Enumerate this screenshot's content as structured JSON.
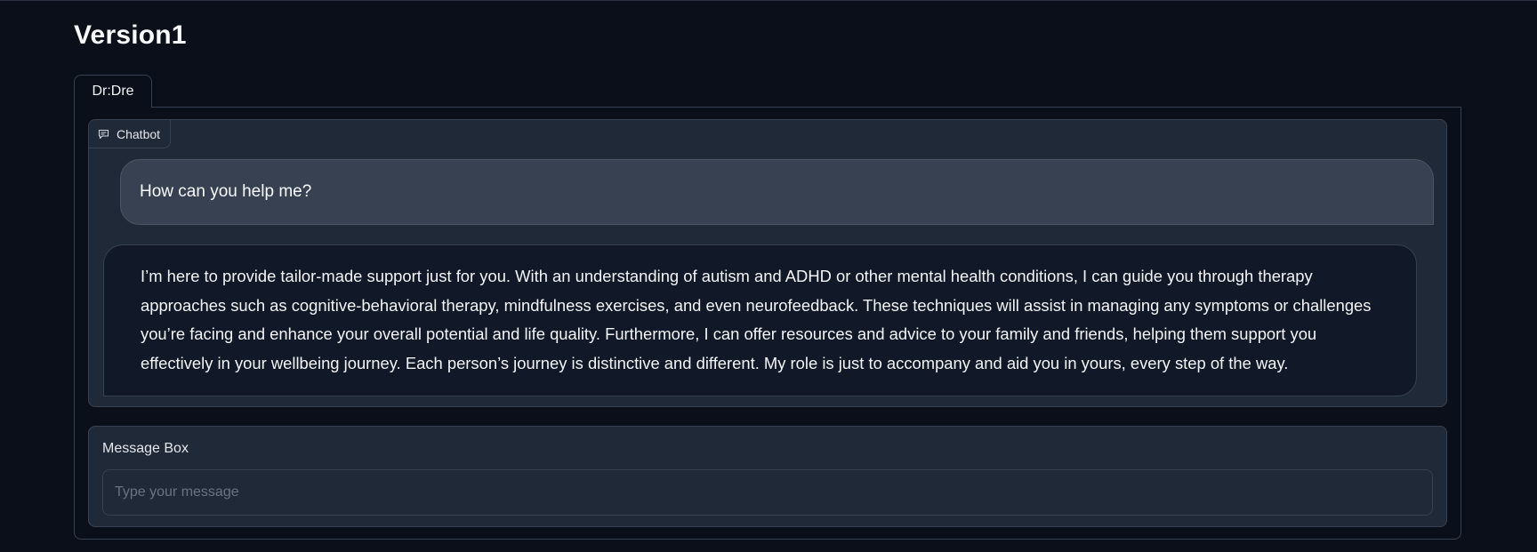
{
  "app": {
    "title": "Version1"
  },
  "tabs": [
    {
      "label": "Dr:Dre",
      "selected": true
    }
  ],
  "chatbot": {
    "label": "Chatbot",
    "icon": "chat-bubble-icon",
    "messages": [
      {
        "role": "user",
        "text": "How can you help me?"
      },
      {
        "role": "bot",
        "text": "I’m here to provide tailor-made support just for you. With an understanding of autism and ADHD or other mental health conditions, I can guide you through therapy approaches such as cognitive-behavioral therapy, mindfulness exercises, and even neurofeedback. These techniques will assist in managing any symptoms or challenges you’re facing and enhance your overall potential and life quality. Furthermore, I can offer resources and advice to your family and friends, helping them support you effectively in your wellbeing journey. Each person’s journey is distinctive and different. My role is just to accompany and aid you in yours, every step of the way."
      }
    ]
  },
  "message_box": {
    "label": "Message Box",
    "placeholder": "Type your message",
    "value": ""
  },
  "colors": {
    "background": "#0b0f19",
    "panel": "#1f2937",
    "user_bubble": "#374151",
    "bot_bubble": "#111827",
    "border": "#374151"
  }
}
